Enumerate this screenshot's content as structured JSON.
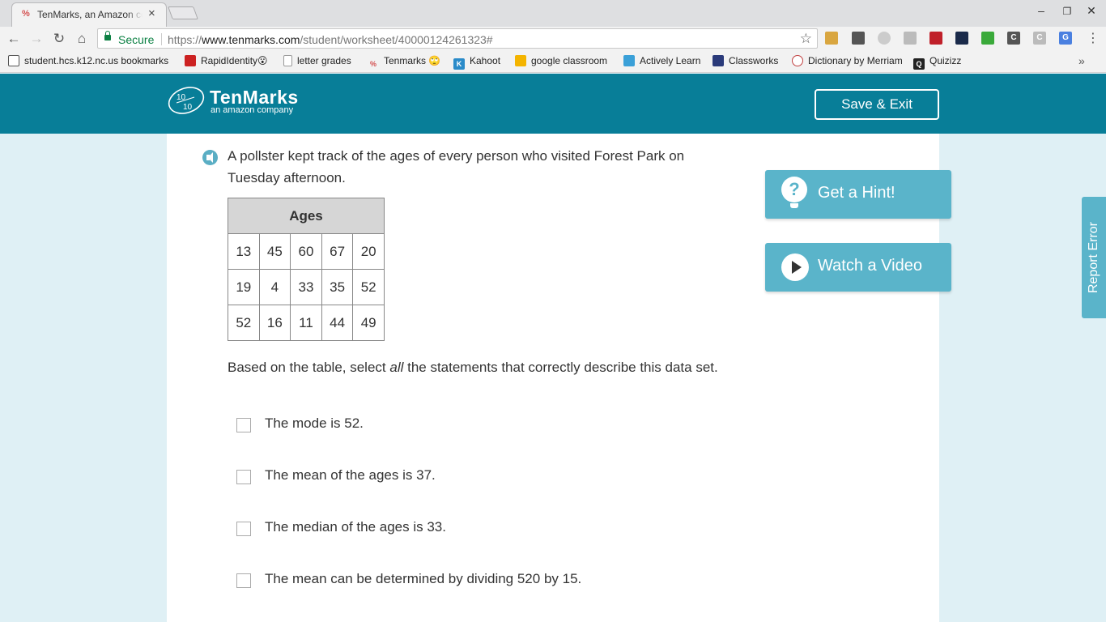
{
  "browser": {
    "tab_title": "TenMarks, an Amazon company",
    "tab_favicon": "%",
    "secure_label": "Secure",
    "url_scheme": "https://",
    "url_host": "www.tenmarks.com",
    "url_path": "/student/worksheet/40000124261323#",
    "menu_icon": "⋮",
    "bookmarks": [
      {
        "label": "student.hcs.k12.nc.us bookmarks",
        "icon": "folder-icon",
        "color": "#555555"
      },
      {
        "label": "RapidIdentity😮",
        "icon": "rapididentity-icon",
        "color": "#cc2222"
      },
      {
        "label": "letter grades",
        "icon": "page-icon",
        "color": "#ffffff"
      },
      {
        "label": "Tenmarks 🙄",
        "icon": "tenmarks-icon",
        "color": "#d45050"
      },
      {
        "label": "Kahoot",
        "icon": "kahoot-icon",
        "color": "#2a8bc9"
      },
      {
        "label": "google classroom",
        "icon": "classroom-icon",
        "color": "#f4b400"
      },
      {
        "label": "Actively Learn",
        "icon": "activelylearn-icon",
        "color": "#3aa0d8"
      },
      {
        "label": "Classworks",
        "icon": "classworks-icon",
        "color": "#2a3a7a"
      },
      {
        "label": "Dictionary by Merriam",
        "icon": "merriam-icon",
        "color": "#c04040"
      },
      {
        "label": "Quizizz",
        "icon": "quizizz-icon",
        "color": "#222222"
      }
    ],
    "bookmarks_more": "»"
  },
  "header": {
    "brand": "TenMarks",
    "brand_sub": "an amazon company",
    "save_exit_label": "Save & Exit",
    "colors": {
      "header_bg": "#087e98",
      "accent": "#5ab4ca"
    }
  },
  "question": {
    "prompt": "A pollster kept track of the ages of every person who visited Forest Park on Tuesday afternoon.",
    "table_header": "Ages",
    "table_rows": [
      [
        "13",
        "45",
        "60",
        "67",
        "20"
      ],
      [
        "19",
        "4",
        "33",
        "35",
        "52"
      ],
      [
        "52",
        "16",
        "11",
        "44",
        "49"
      ]
    ],
    "instruction_before": "Based on the table, select ",
    "instruction_emphasis": "all",
    "instruction_after": " the statements that correctly describe this data set.",
    "options": [
      "The mode is 52.",
      "The mean of the ages is 37.",
      "The median of the ages is 33.",
      "The mean can be determined by dividing 520 by 15."
    ]
  },
  "sidebar": {
    "hint_label": "Get a Hint!",
    "hint_icon_glyph": "?",
    "video_label": "Watch a Video",
    "report_error_label": "Report Error"
  }
}
